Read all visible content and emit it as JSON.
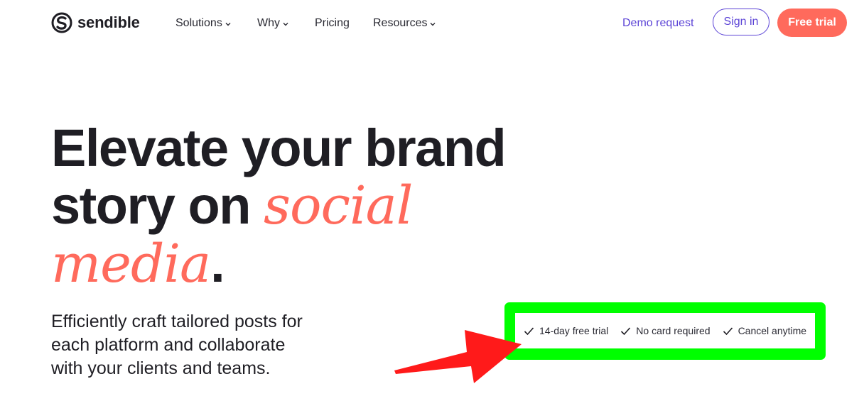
{
  "header": {
    "logo_text": "sendible",
    "nav": [
      {
        "label": "Solutions",
        "has_dropdown": true
      },
      {
        "label": "Why",
        "has_dropdown": true
      },
      {
        "label": "Pricing",
        "has_dropdown": false
      },
      {
        "label": "Resources",
        "has_dropdown": true
      }
    ],
    "demo_label": "Demo request",
    "signin_label": "Sign in",
    "trial_label": "Free trial"
  },
  "hero": {
    "title_part1": "Elevate your brand",
    "title_part2": "story on ",
    "title_accent1": "social",
    "title_accent2": "media",
    "title_end": ".",
    "subtitle": "Efficiently craft tailored posts for each platform and collaborate with your clients and teams."
  },
  "perks": [
    "14-day free trial",
    "No card required",
    "Cancel anytime"
  ],
  "colors": {
    "brand_coral": "#ff6a5c",
    "brand_purple": "#5b43d6",
    "highlight_green": "#00ff00",
    "annotation_arrow": "#ff1a1a"
  },
  "icons": {
    "logo": "sendible-s-logo-icon",
    "dropdown": "chevron-down-icon",
    "perk": "check-icon",
    "annotation": "red-arrow-icon"
  }
}
